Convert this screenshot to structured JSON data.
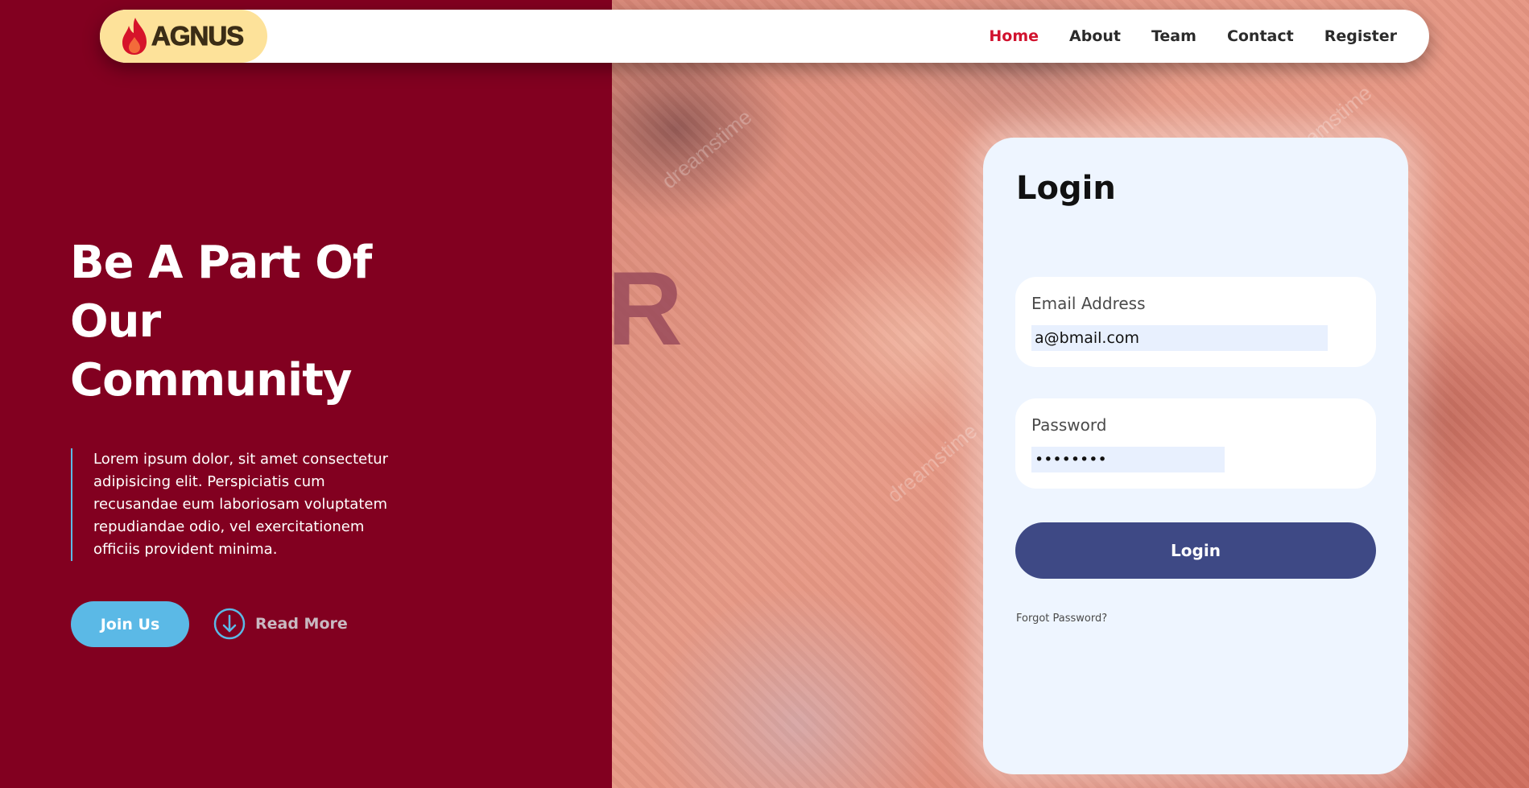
{
  "brand": {
    "name": "AGNUS",
    "logo_icon": "flame-icon"
  },
  "nav": {
    "items": [
      {
        "label": "Home",
        "active": true
      },
      {
        "label": "About",
        "active": false
      },
      {
        "label": "Team",
        "active": false
      },
      {
        "label": "Contact",
        "active": false
      },
      {
        "label": "Register",
        "active": false
      }
    ]
  },
  "hero": {
    "title_lines": [
      "Be A Part Of",
      "Our",
      "Community"
    ],
    "description": "Lorem ipsum dolor, sit amet consectetur adipisicing elit. Perspiciatis cum recusandae eum laboriosam voluptatem repudiandae odio, vel exercitationem officiis provident minima.",
    "join_label": "Join Us",
    "read_more_label": "Read More",
    "read_more_icon": "arrow-down-circle-icon"
  },
  "background": {
    "letter": "R",
    "watermark": "dreamstime"
  },
  "login": {
    "title": "Login",
    "email_label": "Email Address",
    "email_value": "a@bmail.com",
    "password_label": "Password",
    "password_value": "••••••••",
    "submit_label": "Login",
    "forgot_label": "Forgot Password?"
  },
  "colors": {
    "left_bg": "#820020",
    "accent_active": "#d1122e",
    "join_button": "#5bb9e6",
    "login_button": "#3e4985",
    "logo_bg": "#fde29a"
  }
}
